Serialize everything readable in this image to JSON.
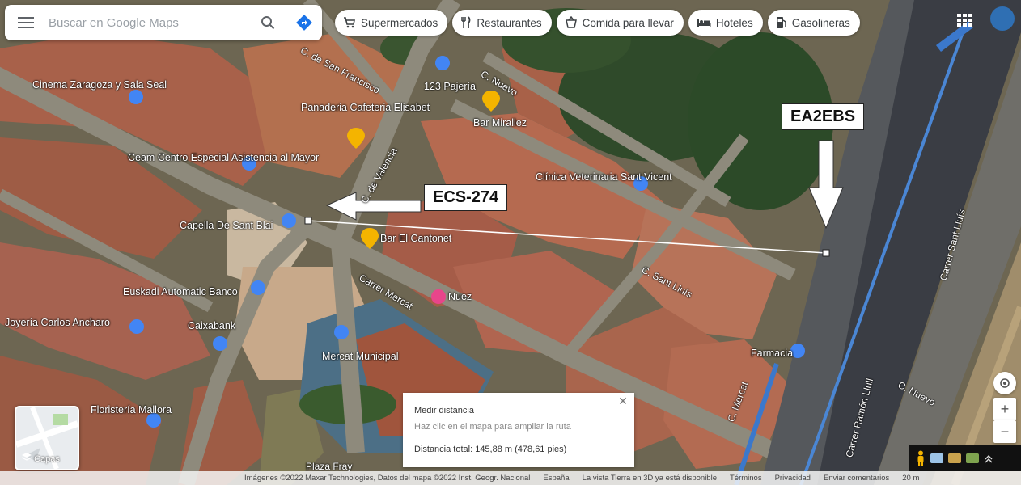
{
  "search": {
    "placeholder": "Buscar en Google Maps"
  },
  "chips": [
    {
      "label": "Supermercados",
      "icon": "cart-icon"
    },
    {
      "label": "Restaurantes",
      "icon": "fork-knife-icon"
    },
    {
      "label": "Comida para llevar",
      "icon": "takeout-icon"
    },
    {
      "label": "Hoteles",
      "icon": "bed-icon"
    },
    {
      "label": "Gasolineras",
      "icon": "gas-pump-icon"
    }
  ],
  "callouts": {
    "ea2ebs": "EA2EBS",
    "ecs274": "ECS-274"
  },
  "places": [
    {
      "name": "Cinema Zaragoza y Sala Seal"
    },
    {
      "name": "Panaderia Cafeteria Elisabet"
    },
    {
      "name": "123 Pajería"
    },
    {
      "name": "Bar Mirallez"
    },
    {
      "name": "Ceam Centro Especial Asistencia al Mayor"
    },
    {
      "name": "Clínica Veterinaria Sant Vicent"
    },
    {
      "name": "Capella De Sant Blai"
    },
    {
      "name": "Bar El Cantonet"
    },
    {
      "name": "Euskadi Automatic Banco"
    },
    {
      "name": "Nuez"
    },
    {
      "name": "Joyería Carlos Ancharo"
    },
    {
      "name": "Mercat Municipal"
    },
    {
      "name": "Caixabank"
    },
    {
      "name": "Floristería Mallora"
    },
    {
      "name": "Farmacia"
    }
  ],
  "streets": [
    {
      "name": "C. Nuevo"
    },
    {
      "name": "C. de Valencia"
    },
    {
      "name": "Carrer Mercat"
    },
    {
      "name": "C. Sant Lluís"
    },
    {
      "name": "C. Nuevo"
    },
    {
      "name": "Carrer Sant Lluís"
    },
    {
      "name": "Carrer Ramón Llull"
    },
    {
      "name": "C. de San Francisco"
    },
    {
      "name": "Plaza Fray"
    },
    {
      "name": "C. Mercat"
    }
  ],
  "measure": {
    "title": "Medir distancia",
    "hint": "Haz clic en el mapa para ampliar la ruta",
    "distance": "Distancia total: 145,88 m (478,61 pies)"
  },
  "layers": {
    "label": "Capas"
  },
  "footer": {
    "credits": "Imágenes ©2022 Maxar Technologies, Datos del mapa ©2022 Inst. Geogr. Nacional",
    "country": "España",
    "earth": "La vista Tierra en 3D ya está disponible",
    "terms": "Términos",
    "privacy": "Privacidad",
    "feedback": "Enviar comentarios",
    "scale": "20 m"
  },
  "controls": {
    "zoom_in": "+",
    "zoom_out": "−"
  },
  "colors": {
    "route_blue": "#1a73e8",
    "measure_line": "#ffffff",
    "pin_yellow": "#f4b400",
    "pin_blue": "#4285f4",
    "pin_pink": "#e8458b"
  }
}
